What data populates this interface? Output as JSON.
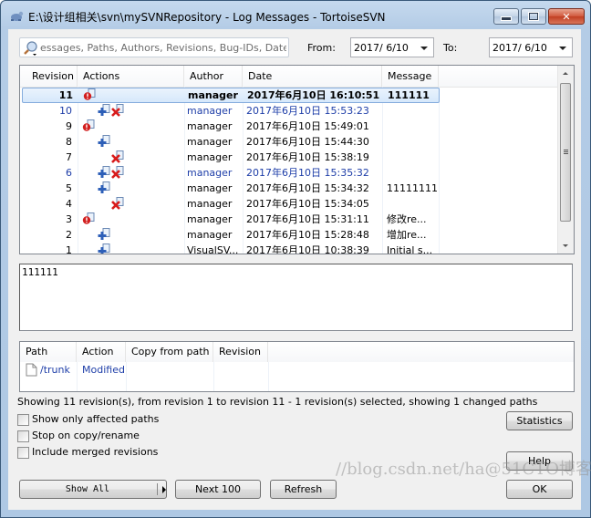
{
  "window": {
    "title": "E:\\设计组相关\\svn\\mySVNRepository - Log Messages - TortoiseSVN",
    "icon": "tortoisesvn-app-icon",
    "controls": {
      "minimize": "minimize-icon",
      "maximize": "maximize-icon",
      "close": "close-icon"
    }
  },
  "filter": {
    "search_placeholder": "essages, Paths, Authors, Revisions, Bug-IDs, Date,",
    "search_icon": "magnifier-icon",
    "from_label": "From:",
    "from_value": "2017/ 6/10",
    "to_label": "To:",
    "to_value": "2017/ 6/10"
  },
  "log": {
    "columns": [
      "Revision",
      "Actions",
      "Author",
      "Date",
      "Message"
    ],
    "rows": [
      {
        "revision": "11",
        "actions": [
          "modified"
        ],
        "author": "manager",
        "date": "2017年6月10日 16:10:51",
        "message": "111111",
        "selected": true,
        "bold": true,
        "blue": false
      },
      {
        "revision": "10",
        "actions": [
          "added",
          "deleted"
        ],
        "author": "manager",
        "date": "2017年6月10日 15:53:23",
        "message": "",
        "selected": false,
        "bold": false,
        "blue": true
      },
      {
        "revision": "9",
        "actions": [
          "modified"
        ],
        "author": "manager",
        "date": "2017年6月10日 15:49:01",
        "message": "",
        "selected": false,
        "bold": false,
        "blue": false
      },
      {
        "revision": "8",
        "actions": [
          "added"
        ],
        "author": "manager",
        "date": "2017年6月10日 15:44:30",
        "message": "",
        "selected": false,
        "bold": false,
        "blue": false
      },
      {
        "revision": "7",
        "actions": [
          "deleted"
        ],
        "author": "manager",
        "date": "2017年6月10日 15:38:19",
        "message": "",
        "selected": false,
        "bold": false,
        "blue": false
      },
      {
        "revision": "6",
        "actions": [
          "added",
          "deleted"
        ],
        "author": "manager",
        "date": "2017年6月10日 15:35:32",
        "message": "",
        "selected": false,
        "bold": false,
        "blue": true
      },
      {
        "revision": "5",
        "actions": [
          "added"
        ],
        "author": "manager",
        "date": "2017年6月10日 15:34:32",
        "message": "11111111",
        "selected": false,
        "bold": false,
        "blue": false
      },
      {
        "revision": "4",
        "actions": [
          "deleted"
        ],
        "author": "manager",
        "date": "2017年6月10日 15:34:05",
        "message": "",
        "selected": false,
        "bold": false,
        "blue": false
      },
      {
        "revision": "3",
        "actions": [
          "modified"
        ],
        "author": "manager",
        "date": "2017年6月10日 15:31:11",
        "message": "修改re...",
        "selected": false,
        "bold": false,
        "blue": false
      },
      {
        "revision": "2",
        "actions": [
          "added"
        ],
        "author": "manager",
        "date": "2017年6月10日 15:28:48",
        "message": "增加re...",
        "selected": false,
        "bold": false,
        "blue": false
      },
      {
        "revision": "1",
        "actions": [
          "added"
        ],
        "author": "VisualSV...",
        "date": "2017年6月10日 10:38:39",
        "message": "Initial s...",
        "selected": false,
        "bold": false,
        "blue": false
      }
    ]
  },
  "message_text": "111111",
  "paths": {
    "columns": [
      "Path",
      "Action",
      "Copy from path",
      "Revision"
    ],
    "rows": [
      {
        "path": "/trunk",
        "action": "Modified",
        "copy_from": "",
        "revision": ""
      }
    ]
  },
  "status_text": "Showing 11 revision(s), from revision 1 to revision 11 - 1 revision(s) selected, showing 1 changed paths",
  "options": [
    {
      "label": "Show only affected paths",
      "checked": false
    },
    {
      "label": "Stop on copy/rename",
      "checked": false
    },
    {
      "label": "Include merged revisions",
      "checked": false
    }
  ],
  "buttons": {
    "statistics": "Statistics",
    "help": "Help",
    "show_all": "Show All",
    "next_100": "Next 100",
    "refresh": "Refresh",
    "ok": "OK"
  },
  "watermark": "//blog.csdn.net/ha@51CTO博客"
}
